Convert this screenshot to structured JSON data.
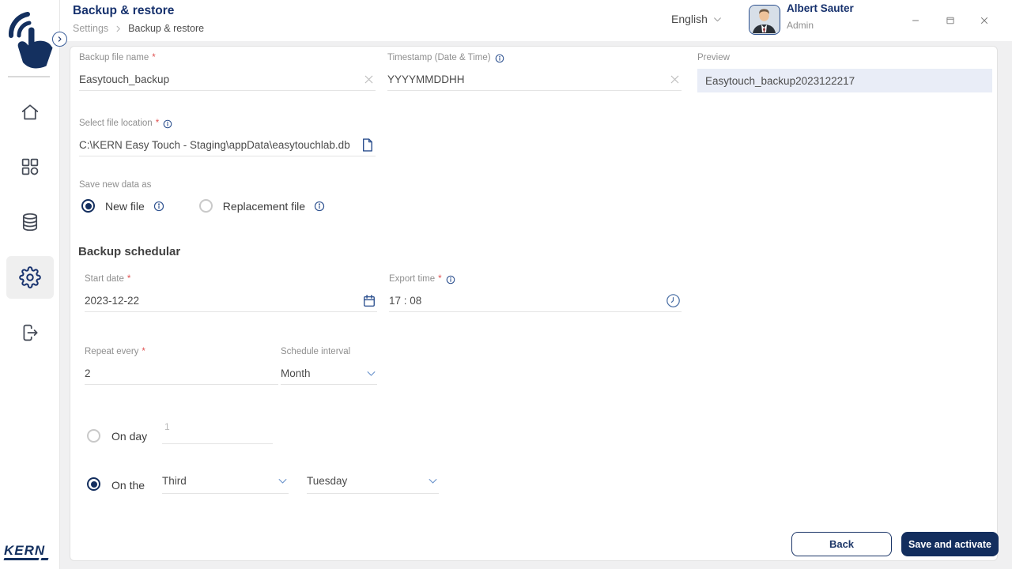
{
  "colors": {
    "navy": "#16316d",
    "icon_blue": "#2b4f8e",
    "button_navy": "#132e5e",
    "preview_bg": "#e9edf7",
    "label_gray": "#8f8f8f",
    "asterisk_red": "#e05252",
    "backdrop_gray": "#f0f0f1"
  },
  "header": {
    "title": "Backup & restore",
    "breadcrumb": {
      "parent": "Settings",
      "current": "Backup & restore",
      "separator_icon": "chevron-right-icon"
    },
    "language": {
      "label": "English",
      "icon": "chevron-down-icon"
    },
    "user": {
      "name": "Albert Sauter",
      "role": "Admin",
      "avatar_icon": "user-photo-avatar"
    },
    "window": {
      "minimize_icon": "minimize-icon",
      "maximize_icon": "maximize-icon",
      "close_icon": "close-icon"
    }
  },
  "sidebar": {
    "logo_icon": "kern-easytouch-hand-logo",
    "expand_icon": "chevron-right-icon",
    "items": [
      {
        "icon": "home-icon",
        "active": false
      },
      {
        "icon": "apps-grid-icon",
        "active": false
      },
      {
        "icon": "database-icon",
        "active": false
      },
      {
        "icon": "settings-gear-icon",
        "active": true
      },
      {
        "icon": "logout-icon",
        "active": false
      }
    ],
    "brand_wordmark": "KERN"
  },
  "form": {
    "backup_file_name": {
      "label": "Backup file name",
      "required": "*",
      "value": "Easytouch_backup",
      "clear_icon": "clear-x-icon"
    },
    "timestamp": {
      "label": "Timestamp (Date & Time)",
      "info_icon": "info-icon",
      "value": "YYYYMMDDHH",
      "clear_icon": "clear-x-icon"
    },
    "preview": {
      "label": "Preview",
      "value": "Easytouch_backup2023122217"
    },
    "file_location": {
      "label": "Select file location",
      "required": "*",
      "info_icon": "info-icon",
      "value": "C:\\KERN Easy Touch - Staging\\appData\\easytouchlab.db",
      "file_icon": "file-icon"
    },
    "save_as": {
      "label": "Save new data as",
      "options": [
        {
          "label": "New file",
          "info_icon": "info-icon",
          "selected": true
        },
        {
          "label": "Replacement file",
          "info_icon": "info-icon",
          "selected": false
        }
      ]
    },
    "scheduler": {
      "heading": "Backup schedular",
      "start_date": {
        "label": "Start date",
        "required": "*",
        "value": "2023-12-22",
        "icon": "calendar-icon"
      },
      "export_time": {
        "label": "Export time",
        "required": "*",
        "info_icon": "info-icon",
        "value": "17 : 08",
        "icon": "clock-icon"
      },
      "repeat_every": {
        "label": "Repeat every",
        "required": "*",
        "value": "2"
      },
      "schedule_interval": {
        "label": "Schedule interval",
        "value": "Month",
        "icon": "chevron-down-icon"
      },
      "monthly_on_day": {
        "label": "On day",
        "placeholder": "1",
        "selected": false
      },
      "monthly_on_the": {
        "label": "On the",
        "ordinal": "Third",
        "weekday": "Tuesday",
        "selected": true
      }
    }
  },
  "footer": {
    "back_label": "Back",
    "save_label": "Save and activate"
  }
}
